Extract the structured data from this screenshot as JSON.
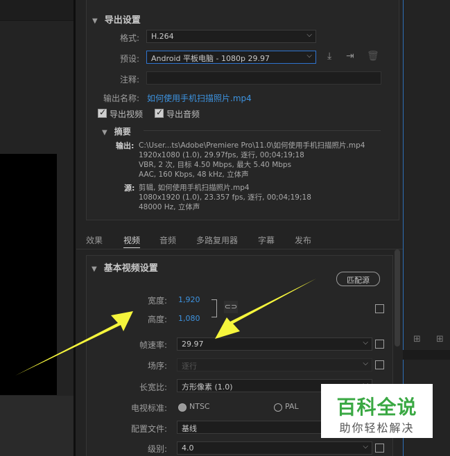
{
  "export_settings": {
    "title": "导出设置",
    "format_label": "格式:",
    "format_value": "H.264",
    "preset_label": "预设:",
    "preset_value": "Android 平板电脑 - 1080p 29.97",
    "comment_label": "注释:",
    "output_name_label": "输出名称:",
    "output_name_value": "如何使用手机扫描照片.mp4",
    "export_video_label": "导出视频",
    "export_audio_label": "导出音频",
    "summary_title": "摘要",
    "summary_output_label": "输出:",
    "summary_output_lines": [
      "C:\\User...ts\\Adobe\\Premiere Pro\\11.0\\如何使用手机扫描照片.mp4",
      "1920x1080 (1.0), 29.97fps, 逐行, 00;04;19;18",
      "VBR, 2 次, 目标 4.50 Mbps, 最大 5.40 Mbps",
      "AAC, 160 Kbps, 48 kHz, 立体声"
    ],
    "summary_source_label": "源:",
    "summary_source_lines": [
      "剪辑, 如何使用手机扫描照片.mp4",
      "1080x1920 (1.0), 23.357 fps, 逐行, 00;04;19;18",
      "48000 Hz, 立体声"
    ]
  },
  "tabs": [
    "效果",
    "视频",
    "音频",
    "多路复用器",
    "字幕",
    "发布"
  ],
  "video": {
    "title": "基本视频设置",
    "match_button": "匹配源",
    "width_label": "宽度:",
    "width_value": "1,920",
    "height_label": "高度:",
    "height_value": "1,080",
    "framerate_label": "帧速率:",
    "framerate_value": "29.97",
    "field_order_label": "场序:",
    "field_order_value": "逐行",
    "aspect_label": "长宽比:",
    "aspect_value": "方形像素 (1.0)",
    "tv_standard_label": "电视标准:",
    "ntsc_label": "NTSC",
    "pal_label": "PAL",
    "profile_label": "配置文件:",
    "profile_value": "基线",
    "level_label": "级别:",
    "level_value": "4.0"
  },
  "watermark": {
    "title": "百科全说",
    "subtitle": "助你轻松解决"
  },
  "colors": {
    "accent_link": "#3d93e0",
    "arrow_yellow": "#f5f53c",
    "watermark_green": "#3aa843"
  }
}
